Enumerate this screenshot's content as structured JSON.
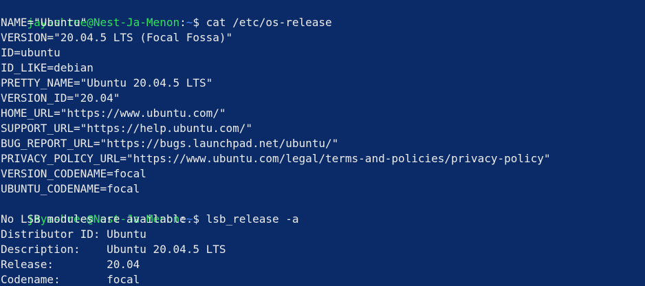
{
  "terminal": {
    "prompt1": {
      "user_host": "jayashree@Nest-Ja-Menon",
      "colon": ":",
      "path": "~",
      "dollar": "$ ",
      "command": "cat /etc/os-release"
    },
    "os_release_lines": [
      "NAME=\"Ubuntu\"",
      "VERSION=\"20.04.5 LTS (Focal Fossa)\"",
      "ID=ubuntu",
      "ID_LIKE=debian",
      "PRETTY_NAME=\"Ubuntu 20.04.5 LTS\"",
      "VERSION_ID=\"20.04\"",
      "HOME_URL=\"https://www.ubuntu.com/\"",
      "SUPPORT_URL=\"https://help.ubuntu.com/\"",
      "BUG_REPORT_URL=\"https://bugs.launchpad.net/ubuntu/\"",
      "PRIVACY_POLICY_URL=\"https://www.ubuntu.com/legal/terms-and-policies/privacy-policy\"",
      "VERSION_CODENAME=focal",
      "UBUNTU_CODENAME=focal"
    ],
    "prompt2": {
      "user_host": "jayashree@Nest-Ja-Menon",
      "colon": ":",
      "path": "~",
      "dollar": "$ ",
      "command": "lsb_release -a"
    },
    "lsb_lines": [
      "No LSB modules are available.",
      "Distributor ID: Ubuntu",
      "Description:    Ubuntu 20.04.5 LTS",
      "Release:        20.04",
      "Codename:       focal"
    ],
    "colors": {
      "background": "#0a2a68",
      "user": "#2ee35a",
      "path": "#4a8cff",
      "text": "#ececec"
    }
  }
}
